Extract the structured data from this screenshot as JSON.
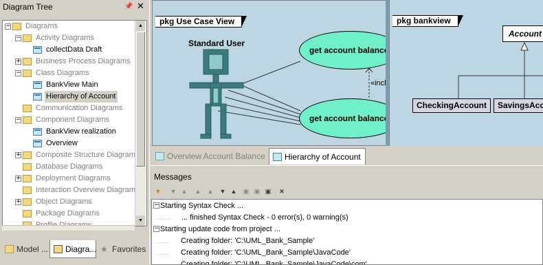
{
  "left_panel": {
    "title": "Diagram Tree",
    "pin_icon": "pin-icon",
    "close_icon": "close-icon",
    "tree": [
      {
        "label": "Diagrams",
        "toggle": "⊟",
        "style": "gray"
      },
      {
        "label": "Activity Diagrams",
        "toggle": "⊟",
        "style": "gray"
      },
      {
        "label": "collectData Draft",
        "style": "normal"
      },
      {
        "label": "Business Process Diagrams",
        "toggle": "⊞",
        "style": "gray"
      },
      {
        "label": "Class Diagrams",
        "toggle": "⊟",
        "style": "gray"
      },
      {
        "label": "BankView Main",
        "style": "normal"
      },
      {
        "label": "Hierarchy of Account",
        "style": "selected"
      },
      {
        "label": "Communication Diagrams",
        "style": "gray"
      },
      {
        "label": "Component Diagrams",
        "toggle": "⊟",
        "style": "gray"
      },
      {
        "label": "BankView realization",
        "style": "normal"
      },
      {
        "label": "Overview",
        "style": "normal"
      },
      {
        "label": "Composite Structure Diagrams",
        "toggle": "⊞",
        "style": "gray"
      },
      {
        "label": "Database Diagrams",
        "style": "gray"
      },
      {
        "label": "Deployment Diagrams",
        "toggle": "⊞",
        "style": "gray"
      },
      {
        "label": "Interaction Overview Diagrams",
        "style": "gray"
      },
      {
        "label": "Object Diagrams",
        "toggle": "⊞",
        "style": "gray"
      },
      {
        "label": "Package Diagrams",
        "style": "gray"
      },
      {
        "label": "Profile Diagrams",
        "style": "gray"
      }
    ],
    "tabs": [
      {
        "label": "Model ...",
        "icon": "model-tree-icon"
      },
      {
        "label": "Diagra...",
        "icon": "diagram-tree-icon",
        "active": true
      },
      {
        "label": "Favorites",
        "icon": "favorites-icon"
      }
    ]
  },
  "diagram1": {
    "package_label": "pkg Use Case View",
    "actor": "Standard User",
    "use_cases": [
      "get account balance",
      "get account balance"
    ],
    "include_label": "«include»",
    "colors": {
      "use_case_fill": "#6ff0c8",
      "actor": "#3a7c7c",
      "background": "#bcd7e3"
    }
  },
  "diagram2": {
    "package_label": "pkg bankview",
    "abstract_class": "Account",
    "classes": [
      "CheckingAccount",
      "SavingsAccount"
    ]
  },
  "doc_tabs": [
    {
      "label": "Overview Account Balance",
      "active": false
    },
    {
      "label": "Hierarchy of Account",
      "active": true
    }
  ],
  "messages": {
    "title": "Messages",
    "toolbar_icons": [
      "filter-icon",
      "down-arrow-icon",
      "up-arrow-icon",
      "first-icon",
      "prev-icon",
      "next-icon",
      "last-icon",
      "copy-icon",
      "copy-all-icon",
      "save-icon",
      "clear-icon"
    ],
    "items": [
      {
        "text": "Starting Syntax Check ...",
        "toggle": "⊟",
        "level": 0
      },
      {
        "text": "... finished Syntax Check - 0 error(s), 0 warning(s)",
        "level": 2
      },
      {
        "text": "Starting update code from project ...",
        "toggle": "⊟",
        "level": 0
      },
      {
        "text": "Creating folder: 'C:\\UML_Bank_Sample'",
        "level": 1
      },
      {
        "text": "Creating folder: 'C:\\UML_Bank_Sample\\JavaCode'",
        "level": 1
      },
      {
        "text": "Creating folder: 'C:\\UML_Bank_Sample\\JavaCode\\com'",
        "level": 1
      }
    ]
  }
}
